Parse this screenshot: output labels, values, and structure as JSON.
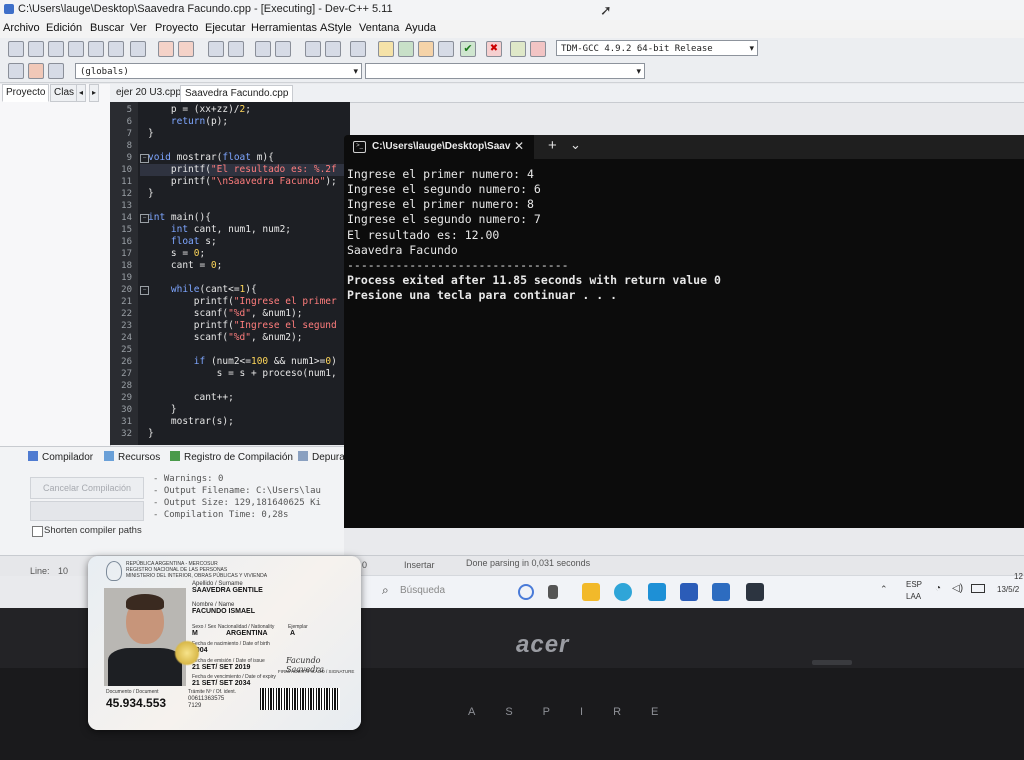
{
  "window": {
    "title": "C:\\Users\\lauge\\Desktop\\Saavedra Facundo.cpp - [Executing] - Dev-C++ 5.11"
  },
  "menu": [
    "Archivo",
    "Edición",
    "Buscar",
    "Ver",
    "Proyecto",
    "Ejecutar",
    "Herramientas",
    "AStyle",
    "Ventana",
    "Ayuda"
  ],
  "toolbar": {
    "compiler_select": "TDM-GCC 4.9.2 64-bit Release",
    "scope_select": "(globals)"
  },
  "left_panel": {
    "tabs": [
      "Proyecto",
      "Clas"
    ]
  },
  "editor_tabs": [
    "ejer 20 U3.cpp",
    "Saavedra Facundo.cpp"
  ],
  "code": [
    {
      "n": "5",
      "text": "    p = (xx+zz)/2;"
    },
    {
      "n": "6",
      "text": "    return(p);"
    },
    {
      "n": "7",
      "text": "}"
    },
    {
      "n": "8",
      "text": ""
    },
    {
      "n": "9",
      "text": "void mostrar(float m){"
    },
    {
      "n": "10",
      "text": "    printf(\"El resultado es: %.2f"
    },
    {
      "n": "11",
      "text": "    printf(\"\\nSaavedra Facundo\");"
    },
    {
      "n": "12",
      "text": "}"
    },
    {
      "n": "13",
      "text": ""
    },
    {
      "n": "14",
      "text": "int main(){"
    },
    {
      "n": "15",
      "text": "    int cant, num1, num2;"
    },
    {
      "n": "16",
      "text": "    float s;"
    },
    {
      "n": "17",
      "text": "    s = 0;"
    },
    {
      "n": "18",
      "text": "    cant = 0;"
    },
    {
      "n": "19",
      "text": ""
    },
    {
      "n": "20",
      "text": "    while(cant<=1){"
    },
    {
      "n": "21",
      "text": "        printf(\"Ingrese el primer"
    },
    {
      "n": "22",
      "text": "        scanf(\"%d\", &num1);"
    },
    {
      "n": "23",
      "text": "        printf(\"Ingrese el segund"
    },
    {
      "n": "24",
      "text": "        scanf(\"%d\", &num2);"
    },
    {
      "n": "25",
      "text": ""
    },
    {
      "n": "26",
      "text": "        if (num2<=100 && num1>=0)"
    },
    {
      "n": "27",
      "text": "            s = s + proceso(num1,"
    },
    {
      "n": "28",
      "text": ""
    },
    {
      "n": "29",
      "text": "        cant++;"
    },
    {
      "n": "30",
      "text": "    }"
    },
    {
      "n": "31",
      "text": "    mostrar(s);"
    },
    {
      "n": "32",
      "text": "}"
    }
  ],
  "console": {
    "tab_title": "C:\\Users\\lauge\\Desktop\\Saav",
    "new_tab": "+",
    "dropdown": "⌄",
    "close": "✕",
    "lines": [
      "Ingrese el primer numero: 4",
      "Ingrese el segundo numero: 6",
      "Ingrese el primer numero: 8",
      "Ingrese el segundo numero: 7",
      "El resultado es: 12.00",
      "Saavedra Facundo",
      "--------------------------------",
      "Process exited after 11.85 seconds with return value 0",
      "Presione una tecla para continuar . . ."
    ]
  },
  "bottom_panel": {
    "tabs": [
      "Compilador",
      "Recursos",
      "Registro de Compilación",
      "Depura"
    ],
    "cancel_button": "Cancelar Compilación",
    "shorten_paths": "Shorten compiler paths",
    "log": [
      "- Warnings: 0",
      "- Output Filename: C:\\Users\\lau",
      "- Output Size: 129,181640625 Ki",
      "- Compilation Time: 0,28s"
    ]
  },
  "status_bar": {
    "line_label": "Line:",
    "line_value": "10",
    "col_value": "0",
    "mode": "Insertar",
    "message": "Done parsing in 0,031 seconds"
  },
  "taskbar": {
    "search_placeholder": "Búsqueda",
    "lang": "ESP",
    "layout": "LAA",
    "time": "12",
    "date": "13/5/2"
  },
  "laptop": {
    "brand": "acer",
    "model": "ASPIRE"
  },
  "id_card": {
    "header1": "REPÚBLICA ARGENTINA - MERCOSUR",
    "header2": "REGISTRO NACIONAL DE LAS PERSONAS",
    "header3": "MINISTERIO DEL INTERIOR, OBRAS PÚBLICAS Y VIVIENDA",
    "surname_label": "Apellido / Surname",
    "surname": "SAAVEDRA GENTILE",
    "name_label": "Nombre / Name",
    "name": "FACUNDO ISMAEL",
    "sex_label": "Sexo / Sex",
    "sex": "M",
    "nationality_label": "Nacionalidad / Nationality",
    "nationality": "ARGENTINA",
    "copy_label": "Ejemplar",
    "copy": "A",
    "birth_label": "Fecha de nacimiento / Date of birth",
    "birth": "2004",
    "issue_label": "Fecha de emisión / Date of issue",
    "issue": "21 SET/ SET 2019",
    "expiry_label": "Fecha de vencimiento / Date of expiry",
    "expiry": "21 SET/ SET 2034",
    "doc_label": "Documento / Document",
    "doc_number": "45.934.553",
    "tramite_label": "Trámite Nº / Of. ident.",
    "tramite": "00611363575",
    "tramite2": "7129",
    "signature_label": "FIRMA IDENTIFICADO / SIGNATURE"
  }
}
